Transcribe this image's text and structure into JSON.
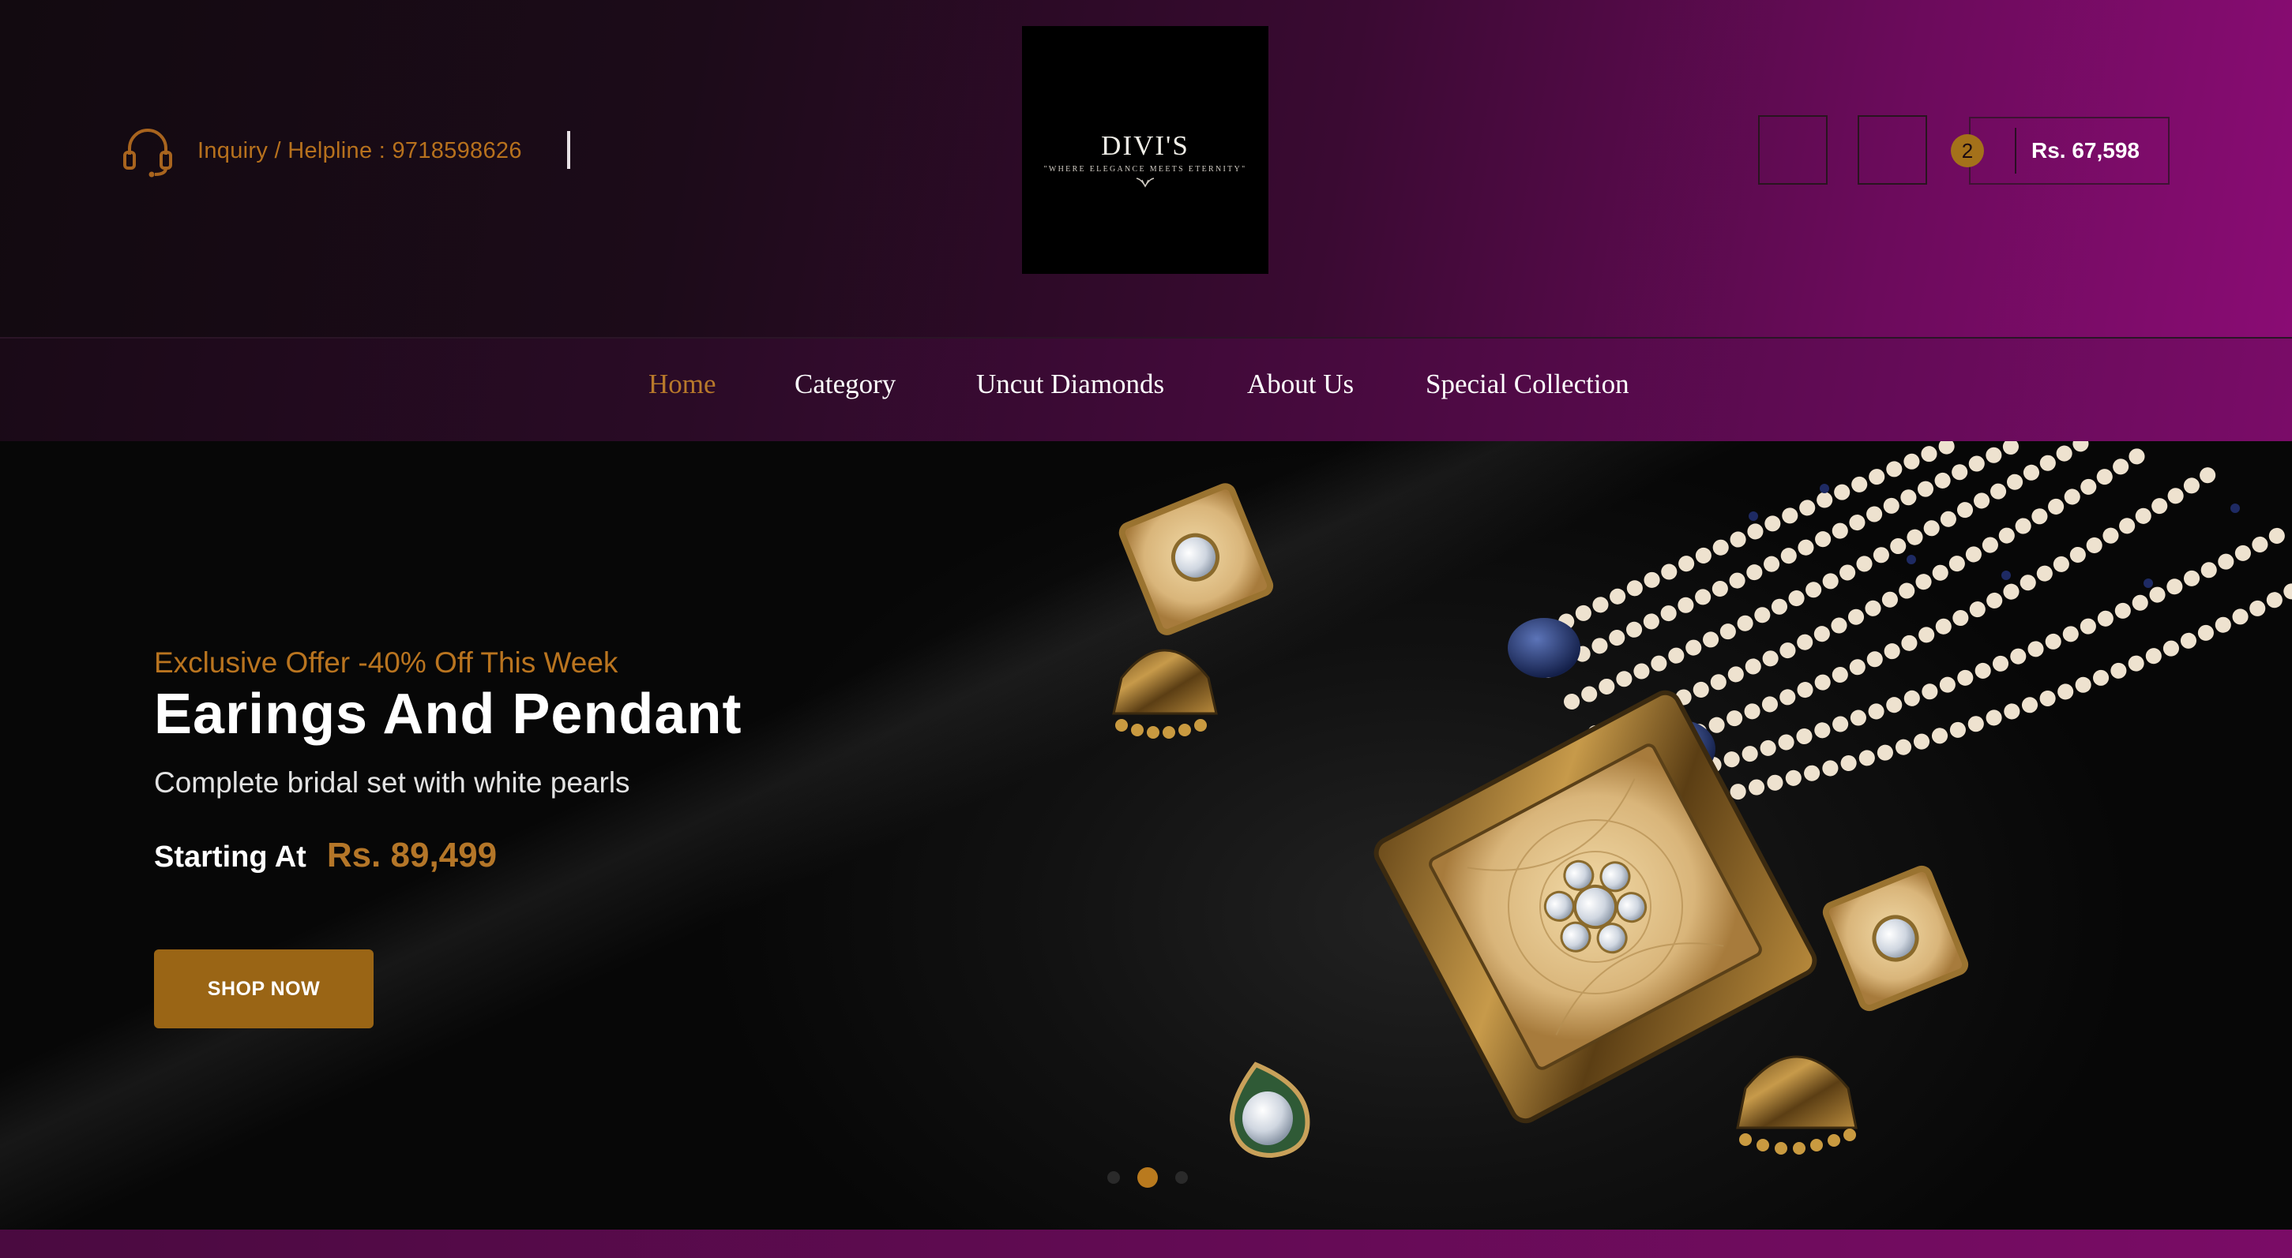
{
  "header": {
    "helpline": "Inquiry / Helpline : 9718598626",
    "logo": {
      "name": "DIVI'S",
      "tagline": "\"WHERE ELEGANCE MEETS ETERNITY\""
    },
    "cart": {
      "count": "2",
      "total": "Rs. 67,598"
    }
  },
  "nav": {
    "items": [
      "Home",
      "Category",
      "Uncut Diamonds",
      "About Us",
      "Special Collection"
    ],
    "active_index": 0
  },
  "hero": {
    "offer": "Exclusive Offer -40% Off This Week",
    "title": "Earings And Pendant",
    "subtitle": "Complete bridal set with white pearls",
    "price_label": "Starting At",
    "price": "Rs. 89,499",
    "cta": "SHOP NOW",
    "slides_total": 3,
    "active_slide": 2
  },
  "icons": {
    "helpline": "headset-icon",
    "cart_badge": "cart-count-badge"
  },
  "colors": {
    "accent_gold": "#b8792b",
    "magenta": "#8a0c74",
    "button": "#9a6515"
  }
}
